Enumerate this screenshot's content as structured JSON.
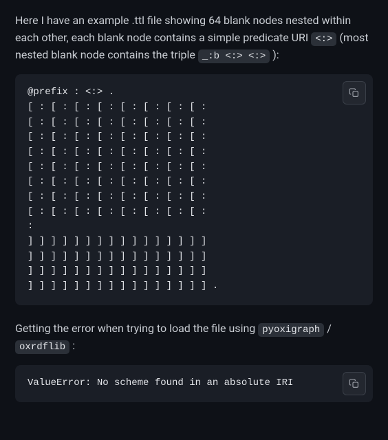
{
  "intro": {
    "pre": "Here I have an example .ttl file showing 64 blank nodes nested within each other, each blank node contains a simple predicate URI ",
    "code1": "<:>",
    "mid": " (most nested blank node contains the triple ",
    "code2": "_:b <:> <:>",
    "post": " ):"
  },
  "ttl_code": "@prefix : <:> .\n[ : [ : [ : [ : [ : [ : [ : [ :\n[ : [ : [ : [ : [ : [ : [ : [ :\n[ : [ : [ : [ : [ : [ : [ : [ :\n[ : [ : [ : [ : [ : [ : [ : [ :\n[ : [ : [ : [ : [ : [ : [ : [ :\n[ : [ : [ : [ : [ : [ : [ : [ :\n[ : [ : [ : [ : [ : [ : [ : [ :\n[ : [ : [ : [ : [ : [ : [ : [ :\n:\n] ] ] ] ] ] ] ] ] ] ] ] ] ] ] ]\n] ] ] ] ] ] ] ] ] ] ] ] ] ] ] ]\n] ] ] ] ] ] ] ] ] ] ] ] ] ] ] ]\n] ] ] ] ] ] ] ] ] ] ] ] ] ] ] ] .",
  "error_intro": {
    "pre": "Getting the error when trying to load the file using ",
    "code1": "pyoxigraph",
    "sep": " / ",
    "code2": "oxrdflib",
    "post": " :"
  },
  "error_code": "ValueError: No scheme found in an absolute IRI",
  "icons": {
    "copy": "copy-icon"
  }
}
